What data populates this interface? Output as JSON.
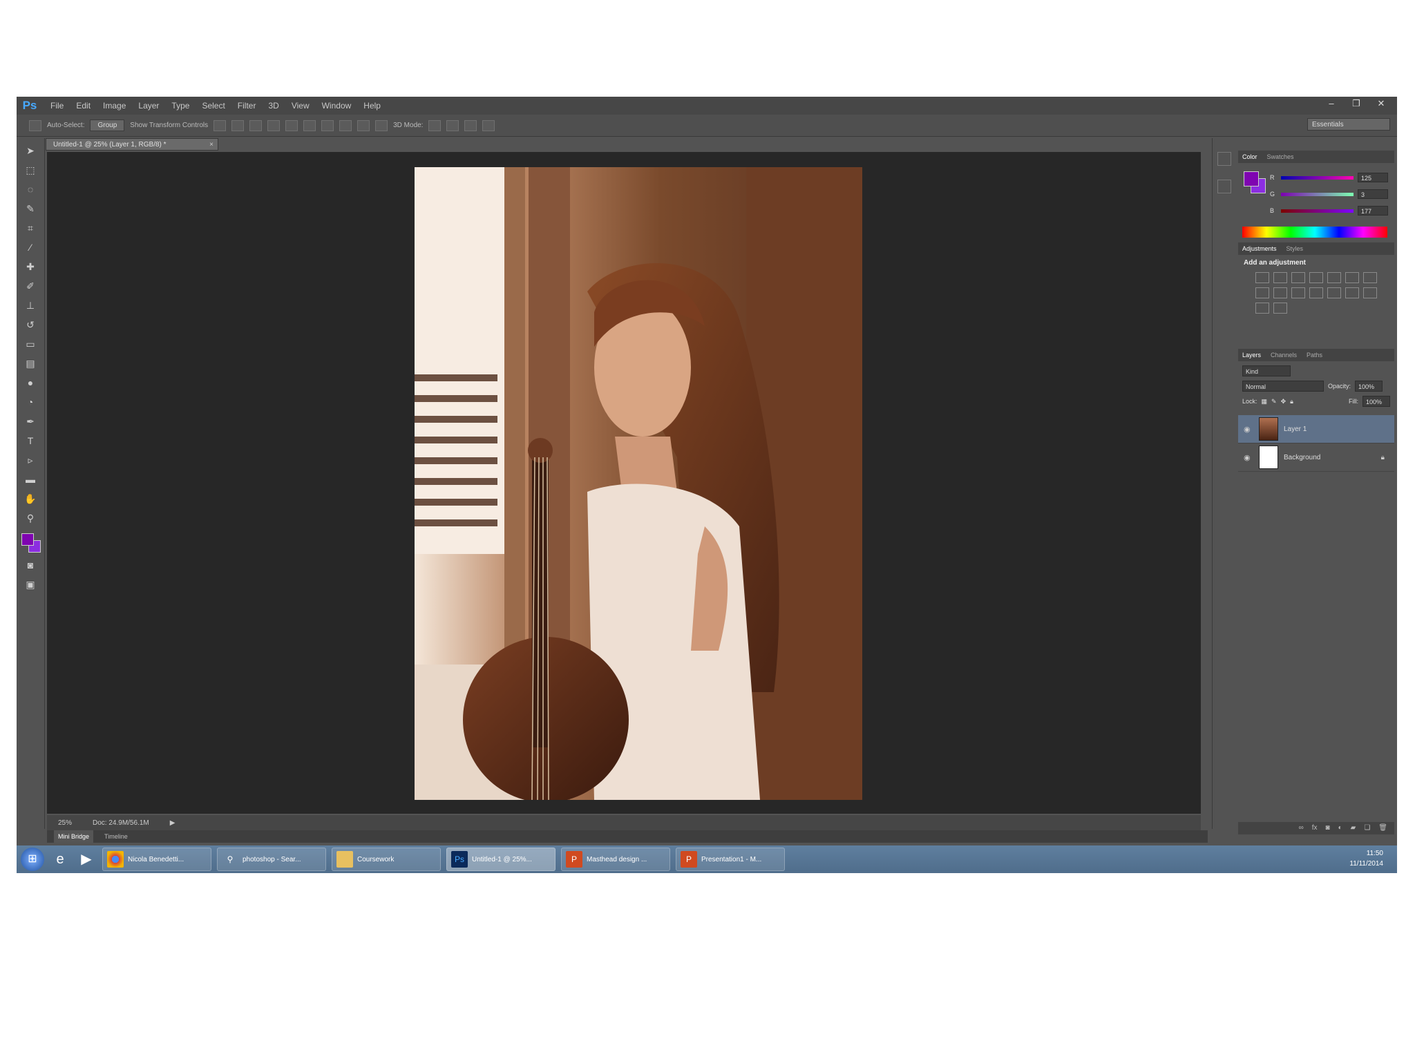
{
  "app": {
    "logo": "Ps"
  },
  "menu": [
    "File",
    "Edit",
    "Image",
    "Layer",
    "Type",
    "Select",
    "Filter",
    "3D",
    "View",
    "Window",
    "Help"
  ],
  "window_controls": [
    "–",
    "❐",
    "✕"
  ],
  "options_bar": {
    "auto_select": "Auto-Select:",
    "auto_select_value": "Group",
    "show_transform": "Show Transform Controls",
    "mode_3d": "3D Mode:",
    "workspace": "Essentials"
  },
  "document_tab": {
    "title": "Untitled-1 @ 25% (Layer 1, RGB/8) *",
    "close": "×"
  },
  "status": {
    "zoom": "25%",
    "doc": "Doc: 24.9M/56.1M"
  },
  "bottom_tabs": [
    "Mini Bridge",
    "Timeline"
  ],
  "colors": {
    "foreground": "#7f05b1",
    "background": "#8c2ee1",
    "selection": "#5f7189"
  },
  "color_panel": {
    "tabs": [
      "Color",
      "Swatches"
    ],
    "rows": [
      {
        "label": "R",
        "value": "125"
      },
      {
        "label": "G",
        "value": "3"
      },
      {
        "label": "B",
        "value": "177"
      }
    ]
  },
  "adjustments": {
    "tabs": [
      "Adjustments",
      "Styles"
    ],
    "title": "Add an adjustment"
  },
  "layers_panel": {
    "tabs": [
      "Layers",
      "Channels",
      "Paths"
    ],
    "filter": "Kind",
    "blend_mode": "Normal",
    "opacity_label": "Opacity:",
    "opacity_value": "100%",
    "lock_label": "Lock:",
    "fill_label": "Fill:",
    "fill_value": "100%",
    "layers": [
      {
        "name": "Layer 1",
        "selected": true
      },
      {
        "name": "Background",
        "selected": false,
        "locked": true
      }
    ]
  },
  "taskbar": {
    "buttons": [
      {
        "label": "Nicola Benedetti..."
      },
      {
        "label": "photoshop - Sear..."
      },
      {
        "label": "Coursework"
      },
      {
        "label": "Untitled-1 @ 25%..."
      },
      {
        "label": "Masthead design ..."
      },
      {
        "label": "Presentation1 - M..."
      }
    ],
    "time": "11:50",
    "date": "11/11/2014"
  }
}
